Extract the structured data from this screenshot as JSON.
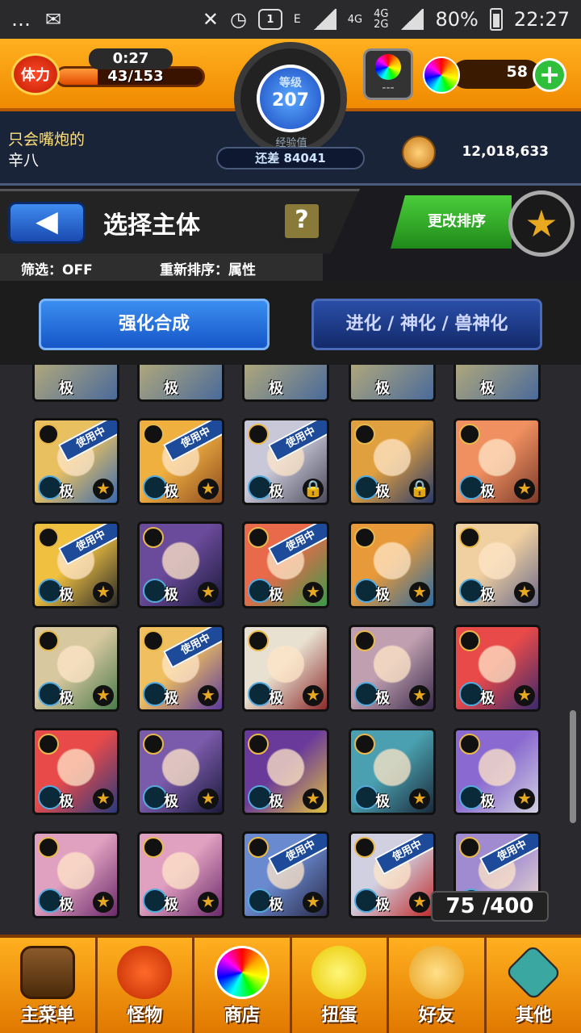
{
  "status_bar": {
    "sim": "1",
    "network": "E",
    "net_4g_1": "4G",
    "net_4g_2": "4G",
    "net_2g": "2G",
    "battery": "80%",
    "time": "22:27"
  },
  "player": {
    "stamina_label": "体力",
    "stamina_timer": "0:27",
    "stamina_value": "43/153",
    "stamina_fraction": 0.28,
    "level_label": "等级",
    "level": "207",
    "exp_label": "经验值",
    "exp_remaining": "还差 84041",
    "crystal_placeholder": "---",
    "orbs": "58",
    "name_line1": "只会嘴炮的",
    "name_line2": "辛八",
    "coins": "12,018,633"
  },
  "screen": {
    "title": "选择主体",
    "help": "?",
    "filter": "筛选：OFF",
    "resort": "重新排序：属性",
    "sort_button": "更改排序"
  },
  "tabs": [
    {
      "label": "强化合成",
      "active": true
    },
    {
      "label": "进化 / 神化 / 兽神化",
      "active": false
    }
  ],
  "box": {
    "count": "75 /400",
    "level_mark": "极",
    "in_use": "使用中"
  },
  "nav": [
    {
      "label": "主菜单",
      "icon": "door-icon"
    },
    {
      "label": "怪物",
      "icon": "monster-icon"
    },
    {
      "label": "商店",
      "icon": "rainbow-orb-icon"
    },
    {
      "label": "扭蛋",
      "icon": "egg-icon"
    },
    {
      "label": "好友",
      "icon": "friends-icon"
    },
    {
      "label": "其他",
      "icon": "help-question-icon"
    }
  ],
  "colors": {
    "header_orange": "#f08a00",
    "primary_blue": "#1656c8",
    "sort_green": "#1f8a1a"
  }
}
